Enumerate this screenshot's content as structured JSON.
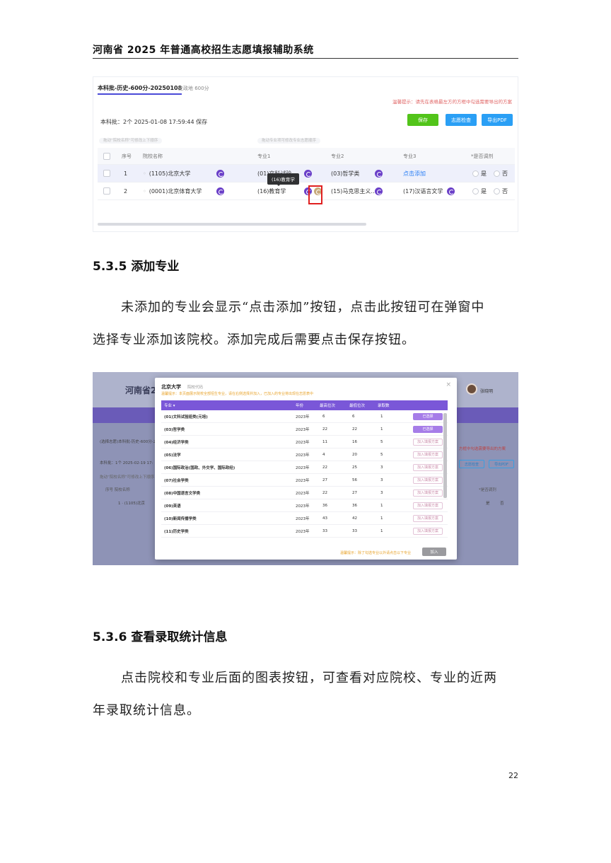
{
  "header": {
    "title": "河南省 2025 年普通高校招生志愿填报辅助系统"
  },
  "shot1": {
    "plan_tab": "本科批-历史-600分-20250108",
    "plan_sub": "史政地 600分",
    "tip": "温馨提示：请先在表格最左方的方框中勾选需要导出的方案",
    "info": "本科批：2个  2025-01-08 17:59:44 保存",
    "btn_save": "保存",
    "btn_check": "志愿检查",
    "btn_pdf": "导出PDF",
    "hint_left": "拖动“院校名称”可修改上下顺序",
    "hint_mid": "拖动专业项可修改专业志愿顺序",
    "headers": {
      "num": "序号",
      "school": "院校名称",
      "m1": "专业1",
      "m2": "专业2",
      "m3": "专业3",
      "adjust": "*是否调剂"
    },
    "rows": [
      {
        "num": "1",
        "school": "(1105)北京大学",
        "m1": "(01)文科试验...",
        "m2": "(03)哲学类",
        "m3": "点击添加",
        "yes": "是",
        "no": "否"
      },
      {
        "num": "2",
        "school": "(0001)北京体育大学",
        "m1": "(16)教育学",
        "m2": "(15)马克思主义…",
        "m3": "(17)汉语言文学",
        "yes": "是",
        "no": "否"
      }
    ],
    "tooltip": "(16)教育学"
  },
  "section1": {
    "title": "5.3.5 添加专业",
    "line1": "未添加的专业会显示“点击添加”按钮，点击此按钮可在弹窗中",
    "line2": "选择专业添加该院校。添加完成后需要点击保存按钮。"
  },
  "shot2": {
    "bg_title": "河南省20",
    "user": "张晓明",
    "bg_plan": "(选择志愿)本科批-历史-600分-2",
    "bg_info": "本科批：1个  2025-02-19 17:",
    "bg_hint": "拖动“院校名称”可修改上下顺序",
    "bg_head": "序号  院校名称",
    "bg_row": "1  · (1105)北京",
    "bg_tip": "方框中勾选需要导出的方案",
    "bg_btn1": "志愿检查",
    "bg_btn2": "导出PDF",
    "bg_adjust": "*是否调剂",
    "bg_yes": "是",
    "bg_no": "否",
    "modal": {
      "title": "北京大学",
      "code": "院校代码",
      "tip": "温馨提示：本页面展示院校全部招生专业，请在右侧选择并加入，已加入的专业将出现在志愿表中",
      "headers": {
        "major": "专业 ▾",
        "year": "年份",
        "min": "最高位次",
        "max": "最低位次",
        "count": "录取数"
      },
      "rows": [
        {
          "major": "(01)文科试验班类(元培)",
          "year": "2023年",
          "a": "6",
          "b": "6",
          "c": "1",
          "btn": "已选择",
          "added": true
        },
        {
          "major": "(03)哲学类",
          "year": "2023年",
          "a": "22",
          "b": "22",
          "c": "1",
          "btn": "已选择",
          "added": true
        },
        {
          "major": "(04)经济学类",
          "year": "2023年",
          "a": "11",
          "b": "16",
          "c": "5",
          "btn": "加入填报方案",
          "added": false
        },
        {
          "major": "(05)法学",
          "year": "2023年",
          "a": "4",
          "b": "20",
          "c": "5",
          "btn": "加入填报方案",
          "added": false
        },
        {
          "major": "(06)国际政治(国政、外交学、国际政经)",
          "year": "2023年",
          "a": "22",
          "b": "25",
          "c": "3",
          "btn": "加入填报方案",
          "added": false
        },
        {
          "major": "(07)社会学类",
          "year": "2023年",
          "a": "27",
          "b": "56",
          "c": "3",
          "btn": "加入填报方案",
          "added": false
        },
        {
          "major": "(08)中国语言文学类",
          "year": "2023年",
          "a": "22",
          "b": "27",
          "c": "3",
          "btn": "加入填报方案",
          "added": false
        },
        {
          "major": "(09)英语",
          "year": "2023年",
          "a": "36",
          "b": "36",
          "c": "1",
          "btn": "加入填报方案",
          "added": false
        },
        {
          "major": "(10)新闻传播学类",
          "year": "2023年",
          "a": "43",
          "b": "42",
          "c": "1",
          "btn": "加入填报方案",
          "added": false
        },
        {
          "major": "(11)历史学类",
          "year": "2023年",
          "a": "33",
          "b": "33",
          "c": "1",
          "btn": "加入填报方案",
          "added": false
        }
      ],
      "foot_tip": "温馨提示：除了勾选专业以外请点击以下专业",
      "add_btn": "加入"
    }
  },
  "section2": {
    "title": "5.3.6 查看录取统计信息",
    "line1": "点击院校和专业后面的图表按钮，可查看对应院校、专业的近两",
    "line2": "年录取统计信息。"
  },
  "page_number": "22"
}
